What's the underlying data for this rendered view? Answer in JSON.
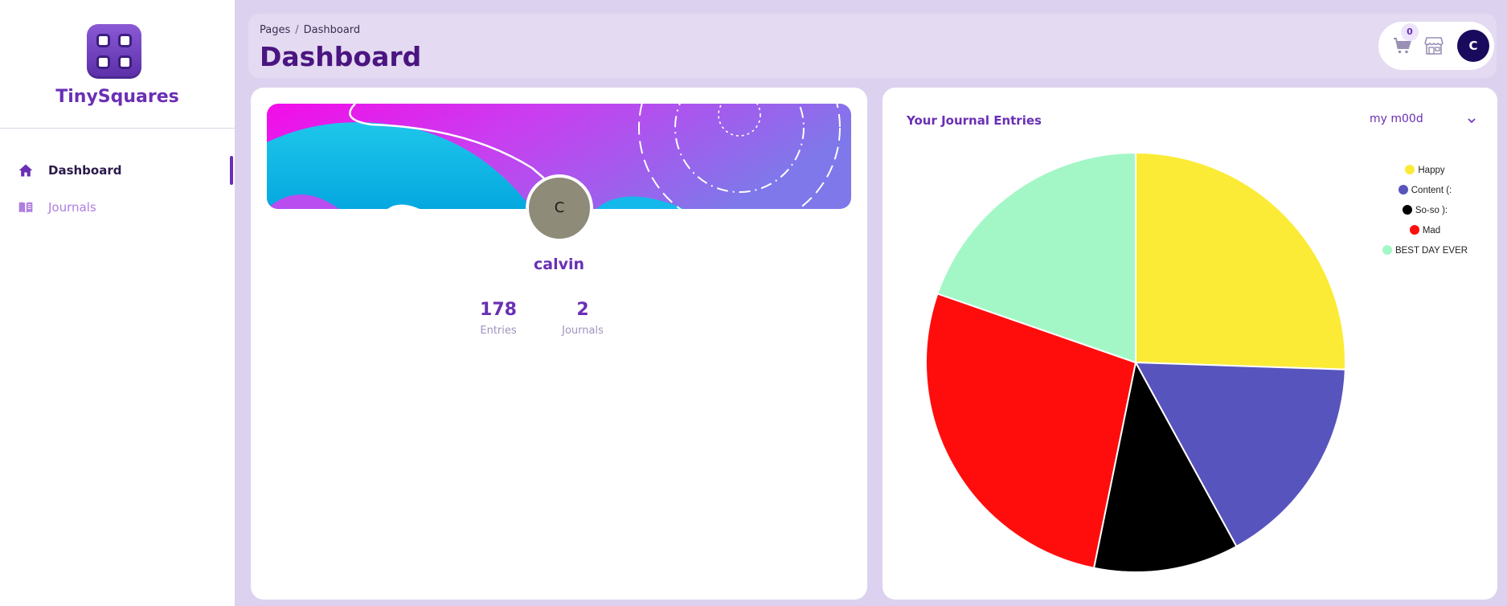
{
  "app": {
    "brand": "TinySquares"
  },
  "sidebar": {
    "items": [
      {
        "label": "Dashboard",
        "icon": "home-icon",
        "active": true
      },
      {
        "label": "Journals",
        "icon": "book-icon",
        "active": false
      }
    ]
  },
  "header": {
    "breadcrumb": {
      "root": "Pages",
      "separator": "/",
      "current": "Dashboard"
    },
    "title": "Dashboard",
    "cart_count": "0",
    "user_initial": "C"
  },
  "profile": {
    "initial": "C",
    "name": "calvin",
    "stats": [
      {
        "value": "178",
        "label": "Entries"
      },
      {
        "value": "2",
        "label": "Journals"
      }
    ]
  },
  "mood_panel": {
    "title": "Your Journal Entries",
    "select_value": "my m00d"
  },
  "colors": {
    "accent": "#6a2fb5",
    "title": "#4a1580",
    "background": "#dcd2ef"
  },
  "chart_data": {
    "type": "pie",
    "title": "",
    "legend_position": "top-right",
    "labels": [
      "Happy",
      "Content (:",
      "So-so ):",
      "Mad",
      "BEST DAY EVER"
    ],
    "values": [
      48,
      31,
      21,
      51,
      37
    ],
    "colors": [
      "#fbeb36",
      "#5854bd",
      "#000000",
      "#ff0d0d",
      "#a3f7c6"
    ]
  }
}
